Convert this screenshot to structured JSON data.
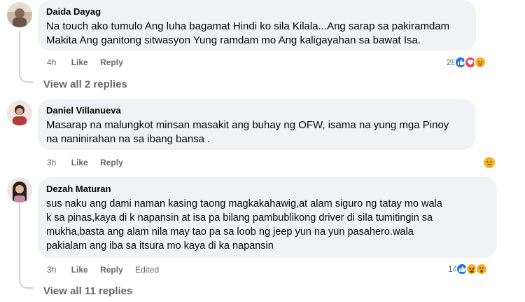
{
  "comments": [
    {
      "name": "Daida Dayag",
      "lines": [
        "Na touch ako tumulo Ang luha bagamat Hindi ko sila Kilala...Ang sarap sa pakiramdam",
        "Makita Ang ganitong sitwasyon Yung ramdam mo Ang kaligayahan sa bawat Isa."
      ],
      "time": "4h",
      "like": "Like",
      "reply": "Reply",
      "reaction_count": "28",
      "reactions": [
        "like-icon",
        "love-icon",
        "care-icon"
      ]
    },
    {
      "name": "Daniel Villanueva",
      "lines": [
        "Masarap na malungkot minsan masakit ang buhay ng OFW, isama na yung mga Pinoy",
        "na naninirahan na sa ibang bansa ."
      ],
      "time": "3h",
      "like": "Like",
      "reply": "Reply",
      "reactions": [
        "sad-icon"
      ]
    },
    {
      "name": "Dezah Maturan",
      "lines": [
        "sus naku ang dami naman kasing taong magkakahawig,at alam siguro ng tatay mo wala",
        "k sa pinas,kaya di k napansin at isa pa bilang pambublikong driver di sila tumitingin sa",
        "mukha,basta ang alam nila may tao pa sa loob ng jeep yun na yun pasahero.wala",
        "pakialam ang iba sa itsura mo kaya di ka napansin"
      ],
      "time": "3h",
      "like": "Like",
      "reply": "Reply",
      "edited": "Edited",
      "reaction_count": "14",
      "reactions": [
        "like-icon",
        "angry-icon",
        "wow-icon"
      ]
    }
  ],
  "view_replies": [
    "View all 2 replies",
    "View all 11 replies"
  ],
  "colors": {
    "bubble": "#f0f2f5",
    "meta": "#65676b",
    "like_blue": "#1877f2",
    "love_red": "#f33e58",
    "emoji_yellow": "#f7b125"
  }
}
